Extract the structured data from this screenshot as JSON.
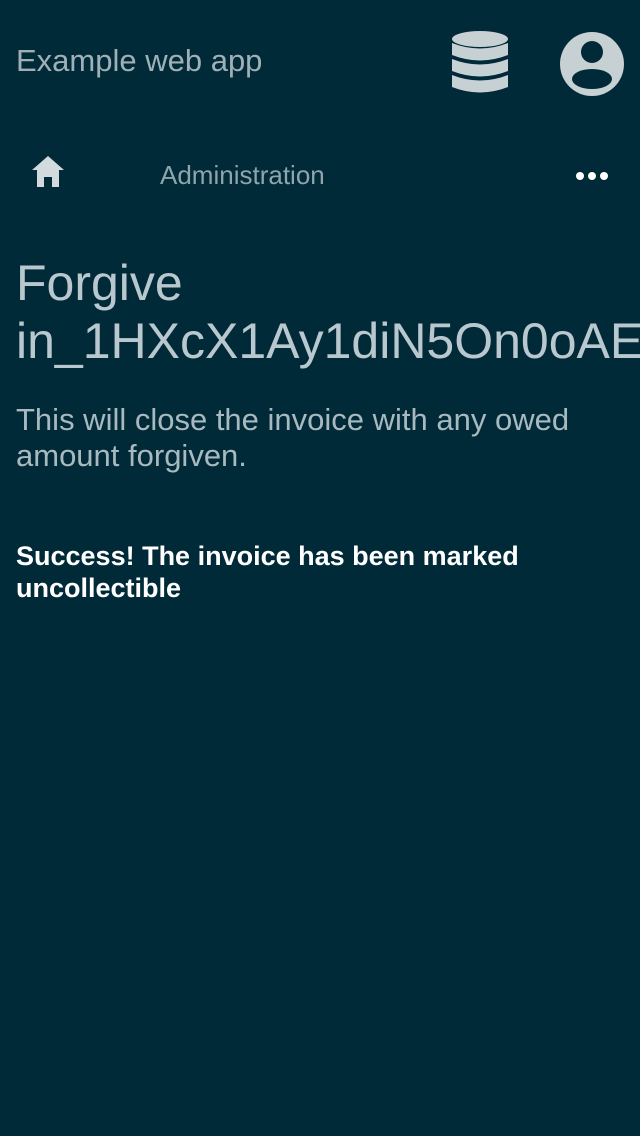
{
  "app": {
    "title": "Example web app"
  },
  "header": {
    "icons": {
      "database": "database-icon",
      "user": "user-circle-icon"
    }
  },
  "navigation": {
    "home_icon": "home-icon",
    "breadcrumb": "Administration",
    "more_icon": "more-horizontal-icon"
  },
  "page": {
    "title_line_1": "Forgive",
    "title_line_2": "in_1HXcX1Ay1diN5On0oAE",
    "description": "This will close the invoice with any owed amount forgiven.",
    "success_message": "Success! The invoice has been marked uncollectible"
  },
  "colors": {
    "background": "#012a38",
    "text_muted": "#9fb0b6",
    "icon": "#c7d0d3",
    "success": "#ffffff"
  }
}
